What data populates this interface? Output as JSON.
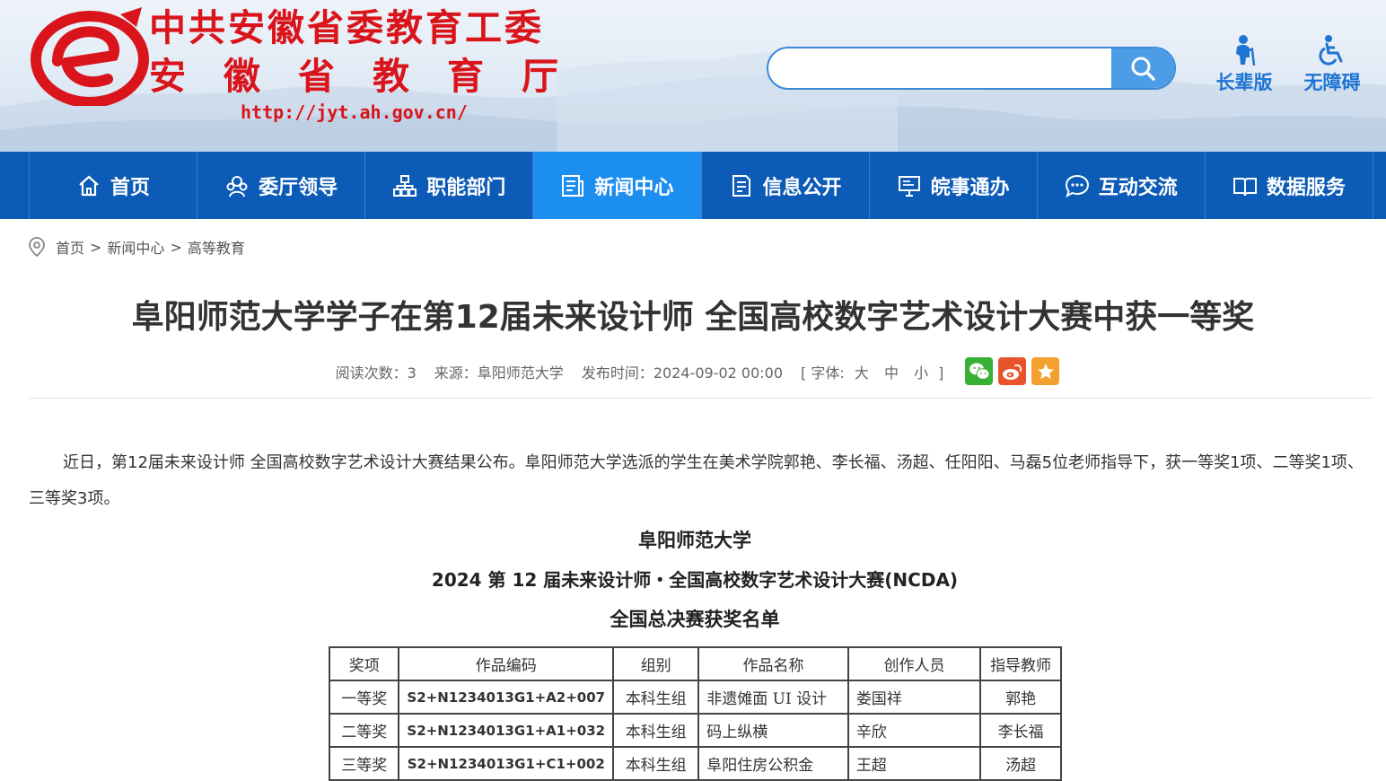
{
  "header": {
    "org_line_1": "中共安徽省委教育工委",
    "org_line_2": "安徽省教育厅",
    "url": "http://jyt.ah.gov.cn/",
    "logo_icon": "e-logo-icon",
    "search": {
      "placeholder": "",
      "button_icon": "search-icon"
    },
    "tools": [
      {
        "label": "长辈版",
        "icon": "elder-icon"
      },
      {
        "label": "无障碍",
        "icon": "wheelchair-icon"
      }
    ],
    "colors": {
      "brand_red": "#d9141b",
      "accent_blue": "#1e74d2"
    }
  },
  "nav": {
    "items": [
      {
        "label": "首页",
        "icon": "home-icon"
      },
      {
        "label": "委厅领导",
        "icon": "leaders-icon"
      },
      {
        "label": "职能部门",
        "icon": "org-chart-icon"
      },
      {
        "label": "新闻中心",
        "icon": "news-icon",
        "active": true
      },
      {
        "label": "信息公开",
        "icon": "document-icon"
      },
      {
        "label": "皖事通办",
        "icon": "monitor-icon"
      },
      {
        "label": "互动交流",
        "icon": "chat-icon"
      },
      {
        "label": "数据服务",
        "icon": "book-icon"
      }
    ],
    "colors": {
      "bar": "#0c5bb6",
      "active": "#1b8ef0"
    }
  },
  "breadcrumb": {
    "icon": "location-pin-icon",
    "items": [
      "首页",
      "新闻中心",
      "高等教育"
    ],
    "separator": ">"
  },
  "article": {
    "title": "阜阳师范大学学子在第12届未来设计师 全国高校数字艺术设计大赛中获一等奖",
    "meta": {
      "reads_label": "阅读次数：",
      "reads_value": "3",
      "source_label": "来源：",
      "source_value": "阜阳师范大学",
      "time_label": "发布时间：",
      "time_value": "2024-09-02 00:00",
      "font_open": "[ 字体:",
      "font_large": "大",
      "font_medium": "中",
      "font_small": "小",
      "font_close": "]",
      "share_icons": [
        "wechat-icon",
        "weibo-icon",
        "favorite-star-icon"
      ]
    },
    "paragraph": "近日，第12届未来设计师 全国高校数字艺术设计大赛结果公布。阜阳师范大学选派的学生在美术学院郭艳、李长福、汤超、任阳阳、马磊5位老师指导下，获一等奖1项、二等奖1项、三等奖3项。",
    "document": {
      "heading_1": "阜阳师范大学",
      "heading_2": "2024 第 12 届未来设计师・全国高校数字艺术设计大赛(NCDA)",
      "heading_3": "全国总决赛获奖名单",
      "table": {
        "headers": [
          "奖项",
          "作品编码",
          "组别",
          "作品名称",
          "创作人员",
          "指导教师"
        ],
        "rows": [
          [
            "一等奖",
            "S2+N1234013G1+A2+007",
            "本科生组",
            "非遗傩面 UI 设计",
            "娄国祥",
            "郭艳"
          ],
          [
            "二等奖",
            "S2+N1234013G1+A1+032",
            "本科生组",
            "码上纵横",
            "辛欣",
            "李长福"
          ],
          [
            "三等奖",
            "S2+N1234013G1+C1+002",
            "本科生组",
            "阜阳住房公积金",
            "王超",
            "汤超"
          ]
        ]
      }
    }
  }
}
